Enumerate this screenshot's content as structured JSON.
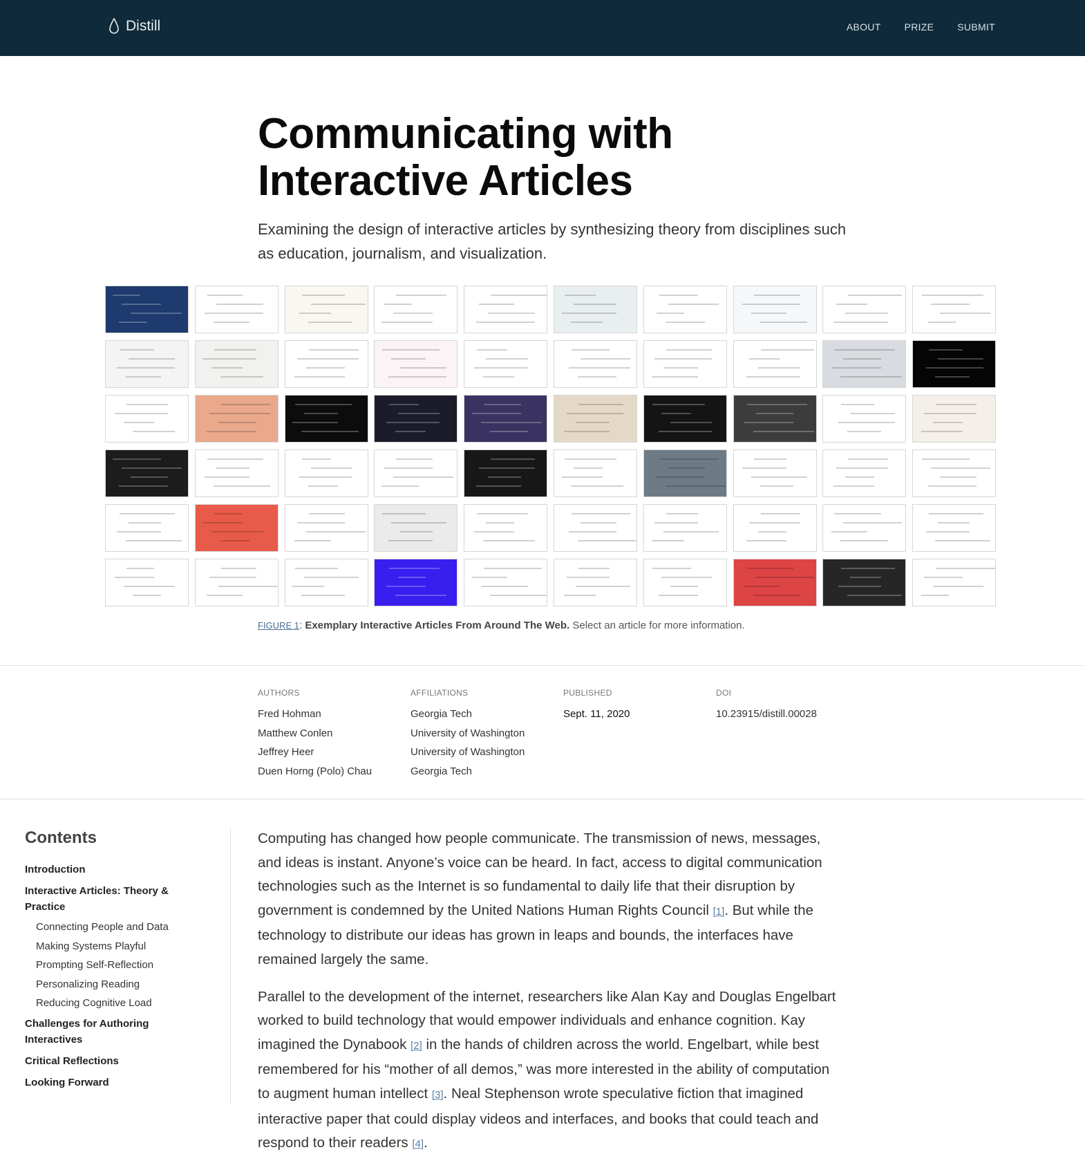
{
  "header": {
    "brand": "Distill",
    "nav": [
      "ABOUT",
      "PRIZE",
      "SUBMIT"
    ]
  },
  "article": {
    "title_line1": "Communicating with",
    "title_line2": "Interactive Articles",
    "subtitle": "Examining the design of interactive articles by synthesizing theory from disciplines such as education, journalism, and visualization."
  },
  "figure": {
    "label": "FIGURE 1",
    "title": "Exemplary Interactive Articles From Around The Web.",
    "text": "Select an article for more information.",
    "thumbnail_colors": [
      "#1e3a6e",
      "#ffffff",
      "#f8f8f0",
      "#ffffff",
      "#ffffff",
      "#e9eef0",
      "#ffffff",
      "#f6f7f8",
      "#ffffff",
      "#ffffff",
      "#f4f4f4",
      "#f1f1ef",
      "#ffffff",
      "#fbf3f5",
      "#ffffff",
      "#ffffff",
      "#ffffff",
      "#ffffff",
      "#d8dce0",
      "#050505",
      "#ffffff",
      "#e9a98a",
      "#0c0c0c",
      "#1b1b2a",
      "#3a3260",
      "#e4d9c6",
      "#141414",
      "#3c3c3c",
      "#ffffff",
      "#f4efe8",
      "#1c1c1c",
      "#ffffff",
      "#ffffff",
      "#ffffff",
      "#171717",
      "#ffffff",
      "#6d7b86",
      "#ffffff",
      "#ffffff",
      "#ffffff",
      "#ffffff",
      "#e85b4a",
      "#ffffff",
      "#ebebeb",
      "#ffffff",
      "#ffffff",
      "#ffffff",
      "#ffffff",
      "#ffffff",
      "#ffffff",
      "#ffffff",
      "#ffffff",
      "#ffffff",
      "#3a1ef0",
      "#ffffff",
      "#ffffff",
      "#ffffff",
      "#dd4444",
      "#262626",
      "#ffffff"
    ]
  },
  "byline": {
    "authors_label": "AUTHORS",
    "authors": [
      "Fred Hohman",
      "Matthew Conlen",
      "Jeffrey Heer",
      "Duen Horng (Polo) Chau"
    ],
    "affiliations_label": "AFFILIATIONS",
    "affiliations": [
      "Georgia Tech",
      "University of Washington",
      "University of Washington",
      "Georgia Tech"
    ],
    "published_label": "PUBLISHED",
    "published": "Sept. 11, 2020",
    "doi_label": "DOI",
    "doi": "10.23915/distill.00028"
  },
  "toc": {
    "heading": "Contents",
    "items": [
      {
        "label": "Introduction",
        "level": 1
      },
      {
        "label": "Interactive Articles: Theory & Practice",
        "level": 1
      },
      {
        "label": "Connecting People and Data",
        "level": 2
      },
      {
        "label": "Making Systems Playful",
        "level": 2
      },
      {
        "label": "Prompting Self-Reflection",
        "level": 2
      },
      {
        "label": "Personalizing Reading",
        "level": 2
      },
      {
        "label": "Reducing Cognitive Load",
        "level": 2
      },
      {
        "label": "Challenges for Authoring Interactives",
        "level": 1
      },
      {
        "label": "Critical Reflections",
        "level": 1
      },
      {
        "label": "Looking Forward",
        "level": 1
      }
    ]
  },
  "body": {
    "p1_a": "Computing has changed how people communicate. The transmission of news, messages, and ideas is instant. Anyone’s voice can be heard. In fact, access to digital communication technologies such as the Internet is so fundamental to daily life that their disruption by government is condemned by the United Nations Human Rights Council ",
    "cite1": "[1]",
    "p1_b": ". But while the technology to distribute our ideas has grown in leaps and bounds, the interfaces have remained largely the same.",
    "p2_a": "Parallel to the development of the internet, researchers like Alan Kay and Douglas Engelbart worked to build technology that would empower individuals and enhance cognition. Kay imagined the Dynabook ",
    "cite2": "[2]",
    "p2_b": " in the hands of children across the world. Engelbart, while best remembered for his “mother of all demos,” was more interested in the ability of computation to augment human intellect ",
    "cite3": "[3]",
    "p2_c": ". Neal Stephenson wrote speculative fiction that imagined interactive paper that could display videos and interfaces, and books that could teach and respond to their readers ",
    "cite4": "[4]",
    "p2_d": "."
  }
}
